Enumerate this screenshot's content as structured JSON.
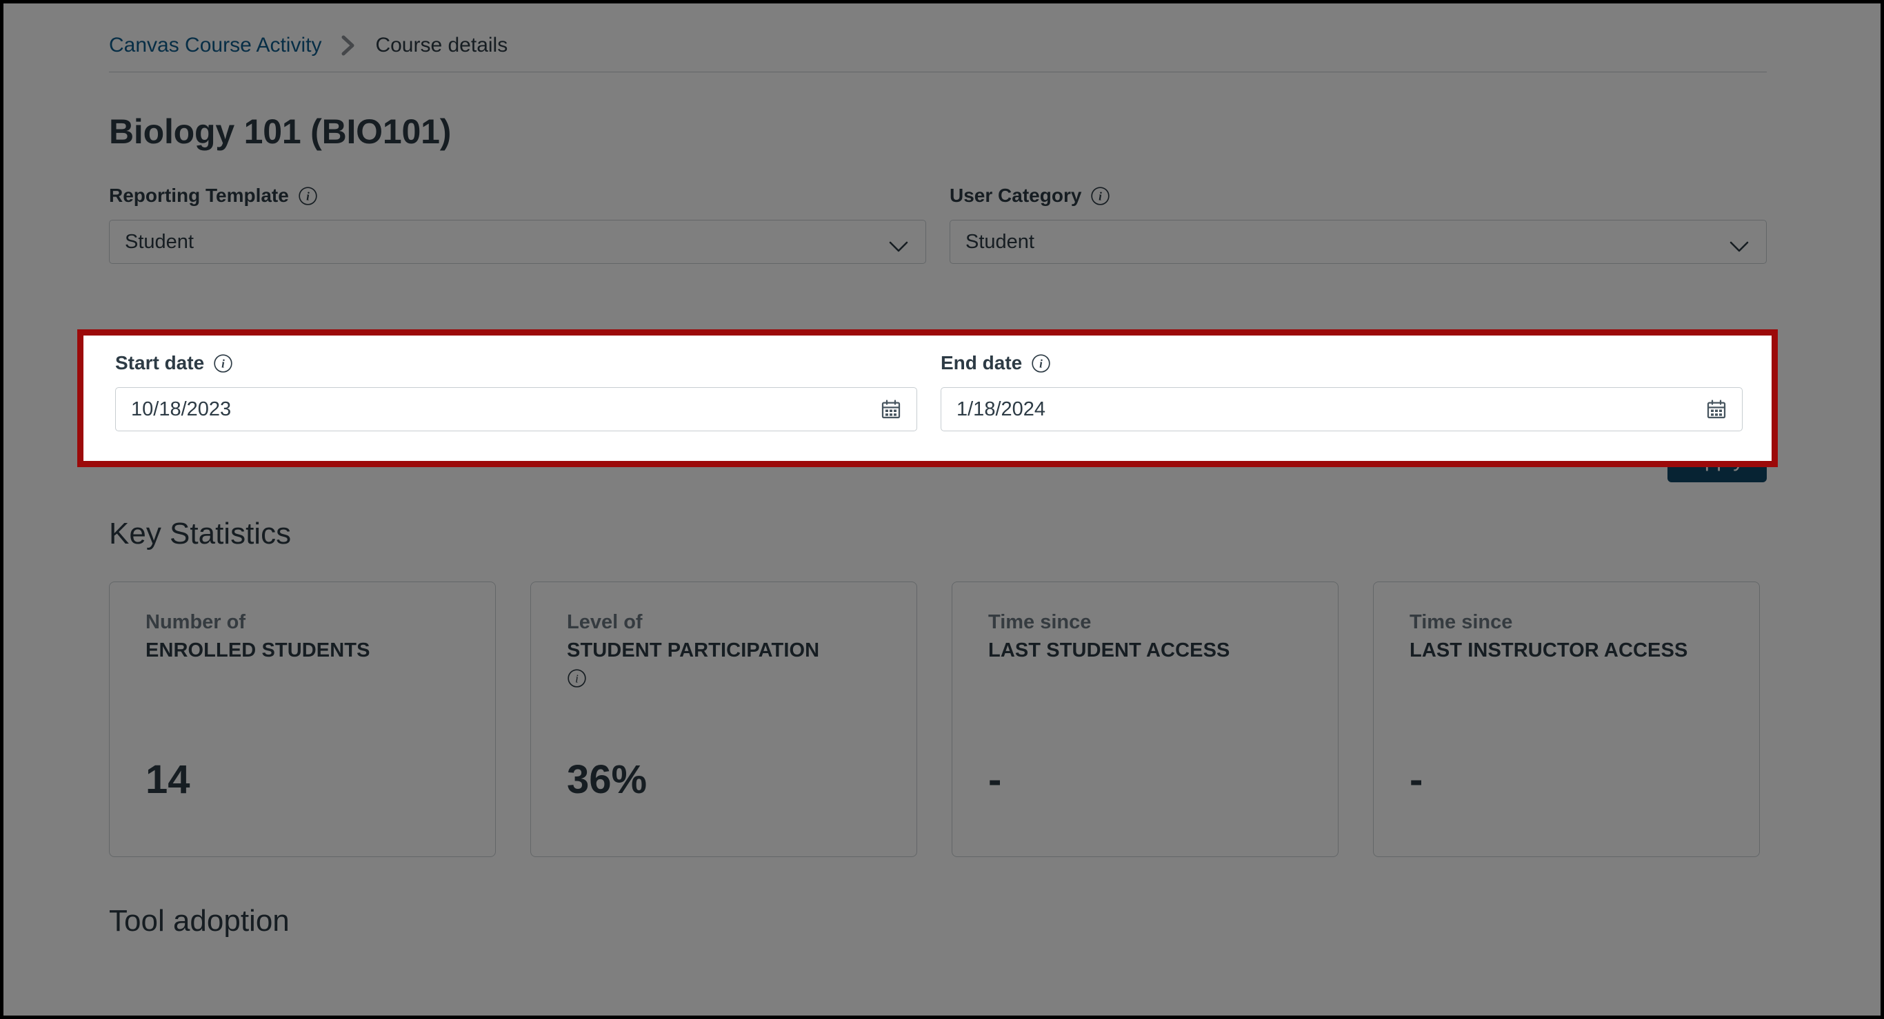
{
  "breadcrumb": {
    "parent": "Canvas Course Activity",
    "separator_icon": "chevron-right-icon",
    "current": "Course details"
  },
  "page_title": "Biology 101 (BIO101)",
  "filters": {
    "reporting_template": {
      "label": "Reporting Template",
      "info_icon": "info-icon",
      "value": "Student",
      "chevron_icon": "chevron-down-icon"
    },
    "user_category": {
      "label": "User Category",
      "info_icon": "info-icon",
      "value": "Student",
      "chevron_icon": "chevron-down-icon"
    },
    "start_date": {
      "label": "Start date",
      "info_icon": "info-icon",
      "value": "10/18/2023",
      "calendar_icon": "calendar-icon"
    },
    "end_date": {
      "label": "End date",
      "info_icon": "info-icon",
      "value": "1/18/2024",
      "calendar_icon": "calendar-icon"
    },
    "apply_label": "Apply"
  },
  "key_statistics": {
    "heading": "Key Statistics",
    "cards": [
      {
        "prefix": "Number of",
        "label": "ENROLLED STUDENTS",
        "has_info_icon": false,
        "value": "14"
      },
      {
        "prefix": "Level of",
        "label": "STUDENT PARTICIPATION",
        "has_info_icon": true,
        "value": "36%"
      },
      {
        "prefix": "Time since",
        "label": "LAST STUDENT ACCESS",
        "has_info_icon": false,
        "value": "-"
      },
      {
        "prefix": "Time since",
        "label": "LAST INSTRUCTOR ACCESS",
        "has_info_icon": false,
        "value": "-"
      }
    ]
  },
  "tool_adoption": {
    "heading": "Tool adoption"
  },
  "colors": {
    "link": "#0E5C8C",
    "text": "#2D3B45",
    "muted": "#6B7780",
    "border": "#C7CDD1",
    "highlight": "#9C0A0A",
    "apply_bg": "#0E4666",
    "overlay": "#808080"
  }
}
